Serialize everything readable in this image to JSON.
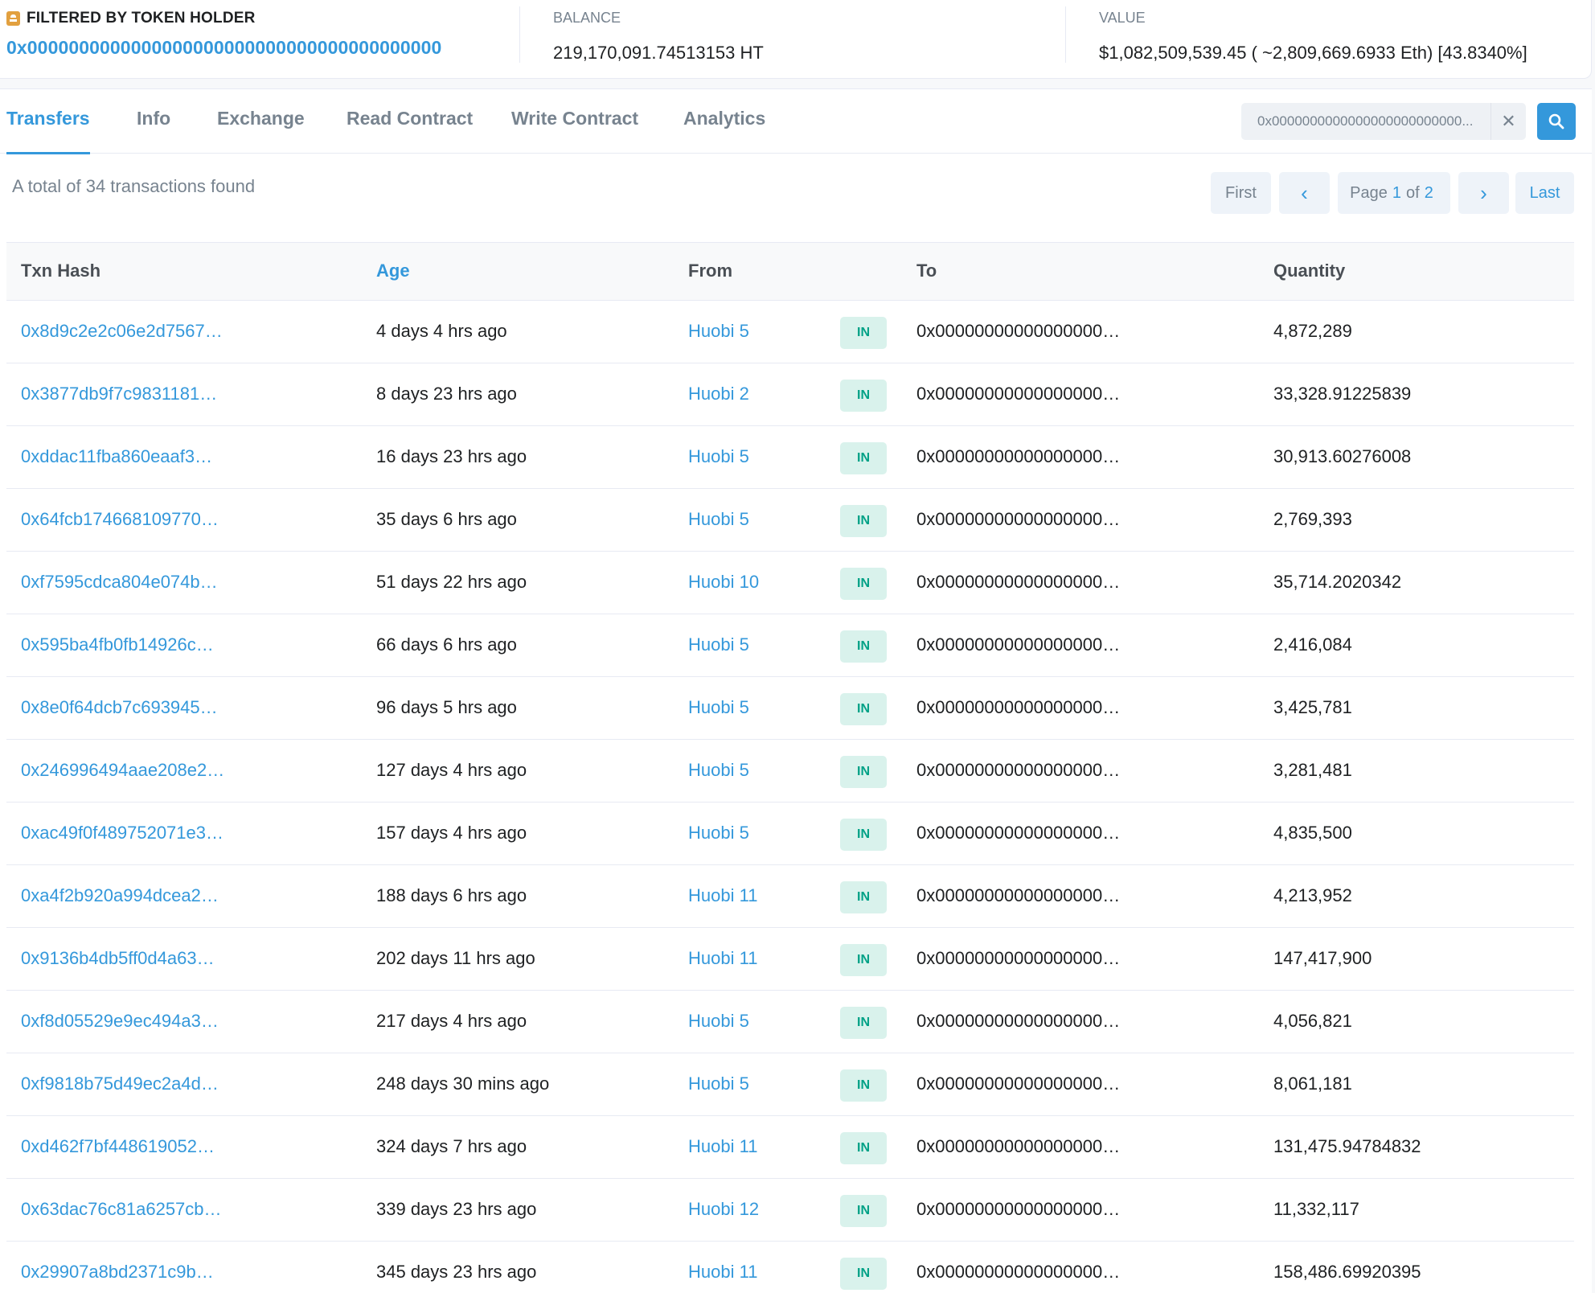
{
  "holder": {
    "filter_label": "FILTERED BY TOKEN HOLDER",
    "address": "0x0000000000000000000000000000000000000000",
    "balance_label": "BALANCE",
    "balance_value": "219,170,091.74513153 HT",
    "value_label": "VALUE",
    "value_value": "$1,082,509,539.45 ( ~2,809,669.6933 Eth) [43.8340%]"
  },
  "tabs": [
    "Transfers",
    "Info",
    "Exchange",
    "Read Contract",
    "Write Contract",
    "Analytics"
  ],
  "search": {
    "value": "0x0000000000000000000000000...",
    "clear": "✕"
  },
  "summary_text": "A total of 34 transactions found",
  "pager": {
    "first": "First",
    "prev": "‹",
    "page_prefix": "Page",
    "page_current": "1",
    "page_of": "of",
    "page_total": "2",
    "next": "›",
    "last": "Last"
  },
  "table": {
    "headers": {
      "hash": "Txn Hash",
      "age": "Age",
      "from": "From",
      "to": "To",
      "qty": "Quantity"
    },
    "rows": [
      {
        "hash": "0x8d9c2e2c06e2d7567…",
        "age": "4 days 4 hrs ago",
        "from": "Huobi 5",
        "dir": "IN",
        "to": "0x00000000000000000…",
        "qty": "4,872,289"
      },
      {
        "hash": "0x3877db9f7c9831181…",
        "age": "8 days 23 hrs ago",
        "from": "Huobi 2",
        "dir": "IN",
        "to": "0x00000000000000000…",
        "qty": "33,328.91225839"
      },
      {
        "hash": "0xddac11fba860eaaf3…",
        "age": "16 days 23 hrs ago",
        "from": "Huobi 5",
        "dir": "IN",
        "to": "0x00000000000000000…",
        "qty": "30,913.60276008"
      },
      {
        "hash": "0x64fcb174668109770…",
        "age": "35 days 6 hrs ago",
        "from": "Huobi 5",
        "dir": "IN",
        "to": "0x00000000000000000…",
        "qty": "2,769,393"
      },
      {
        "hash": "0xf7595cdca804e074b…",
        "age": "51 days 22 hrs ago",
        "from": "Huobi 10",
        "dir": "IN",
        "to": "0x00000000000000000…",
        "qty": "35,714.2020342"
      },
      {
        "hash": "0x595ba4fb0fb14926c…",
        "age": "66 days 6 hrs ago",
        "from": "Huobi 5",
        "dir": "IN",
        "to": "0x00000000000000000…",
        "qty": "2,416,084"
      },
      {
        "hash": "0x8e0f64dcb7c693945…",
        "age": "96 days 5 hrs ago",
        "from": "Huobi 5",
        "dir": "IN",
        "to": "0x00000000000000000…",
        "qty": "3,425,781"
      },
      {
        "hash": "0x246996494aae208e2…",
        "age": "127 days 4 hrs ago",
        "from": "Huobi 5",
        "dir": "IN",
        "to": "0x00000000000000000…",
        "qty": "3,281,481"
      },
      {
        "hash": "0xac49f0f489752071e3…",
        "age": "157 days 4 hrs ago",
        "from": "Huobi 5",
        "dir": "IN",
        "to": "0x00000000000000000…",
        "qty": "4,835,500"
      },
      {
        "hash": "0xa4f2b920a994dcea2…",
        "age": "188 days 6 hrs ago",
        "from": "Huobi 11",
        "dir": "IN",
        "to": "0x00000000000000000…",
        "qty": "4,213,952"
      },
      {
        "hash": "0x9136b4db5ff0d4a63…",
        "age": "202 days 11 hrs ago",
        "from": "Huobi 11",
        "dir": "IN",
        "to": "0x00000000000000000…",
        "qty": "147,417,900"
      },
      {
        "hash": "0xf8d05529e9ec494a3…",
        "age": "217 days 4 hrs ago",
        "from": "Huobi 5",
        "dir": "IN",
        "to": "0x00000000000000000…",
        "qty": "4,056,821"
      },
      {
        "hash": "0xf9818b75d49ec2a4d…",
        "age": "248 days 30 mins ago",
        "from": "Huobi 5",
        "dir": "IN",
        "to": "0x00000000000000000…",
        "qty": "8,061,181"
      },
      {
        "hash": "0xd462f7bf448619052…",
        "age": "324 days 7 hrs ago",
        "from": "Huobi 11",
        "dir": "IN",
        "to": "0x00000000000000000…",
        "qty": "131,475.94784832"
      },
      {
        "hash": "0x63dac76c81a6257cb…",
        "age": "339 days 23 hrs ago",
        "from": "Huobi 12",
        "dir": "IN",
        "to": "0x00000000000000000…",
        "qty": "11,332,117"
      },
      {
        "hash": "0x29907a8bd2371c9b…",
        "age": "345 days 23 hrs ago",
        "from": "Huobi 11",
        "dir": "IN",
        "to": "0x00000000000000000…",
        "qty": "158,486.69920395"
      }
    ]
  },
  "colors": {
    "link": "#3498db",
    "muted": "#77838f",
    "badge_bg": "#d9f2ec",
    "badge_text": "#00a186",
    "accent_icon": "#e2a03f"
  }
}
